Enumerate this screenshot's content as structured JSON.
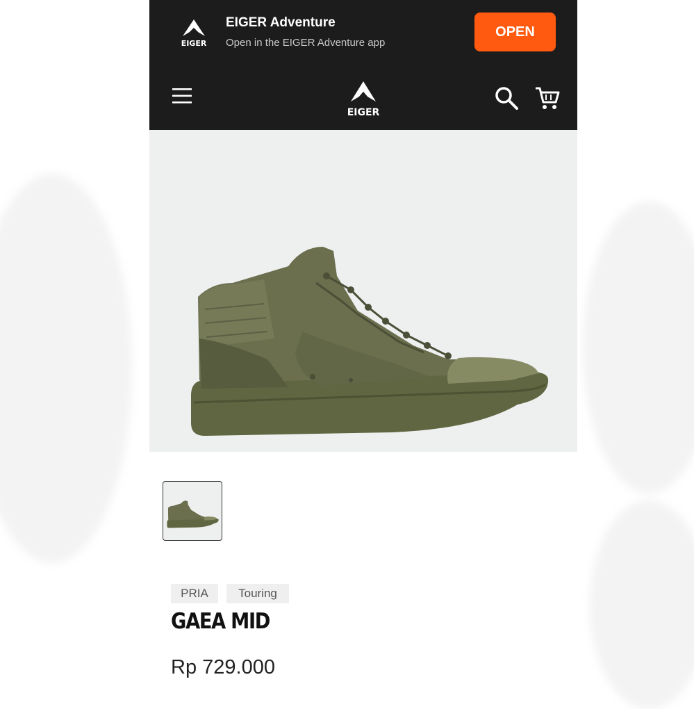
{
  "app_banner": {
    "title": "EIGER Adventure",
    "subtitle": "Open in the EIGER Adventure app",
    "open_label": "OPEN",
    "logo_text": "EIGER"
  },
  "header": {
    "logo_text": "EIGER",
    "icons": [
      "menu-icon",
      "search-icon",
      "cart-icon"
    ]
  },
  "product": {
    "tags": [
      "PRIA",
      "Touring"
    ],
    "name": "GAEA MID",
    "price": "Rp 729.000",
    "thumbnail_count": 1
  },
  "colors": {
    "header_bg": "#1c1c1c",
    "accent": "#ff5a0f",
    "product_color": "#5b6143"
  }
}
